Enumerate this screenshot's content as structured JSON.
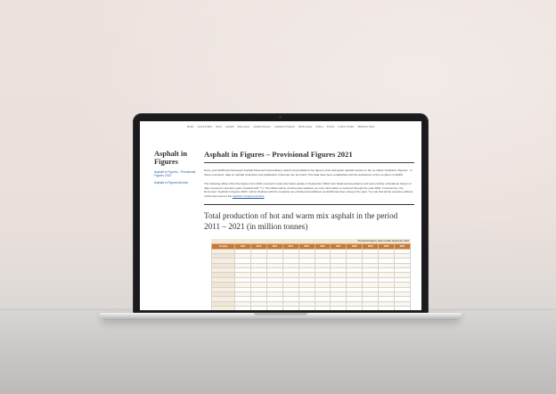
{
  "nav": {
    "items": [
      "Home",
      "About EAPA",
      "News",
      "Asphalt",
      "Innovation",
      "Asphalt Science",
      "Asphalt in Figures",
      "Publications",
      "Videos",
      "Events",
      "Contact EAPA",
      "Members Only"
    ]
  },
  "sidebar": {
    "title": "Asphalt in Figures",
    "links": [
      "Asphalt in Figures – Provisional Figures 2021",
      "Asphalt in Figures Archive"
    ]
  },
  "main": {
    "title": "Asphalt in Figures – Provisional Figures 2021",
    "intro": "Every year EAPA (the European Asphalt Pavement Association) collects and publishes key figures of the European asphalt industry in the so-called \"Asphalt in Figures\". In these overviews, data on asphalt production and application in Europe can be found. This data have been established with the assistance of the members of EAPA.",
    "body": "The following tables show the figures from 2021 received to date (the latest update is September 2022) from National Associations and some further estimations based on data received in previous years (marked with \"*\"). The tables will be continuously updated, as more information is received through the year 2022. In December, the Document \"Asphalt in Figures 2021\" will be finalised with the complete set of data and published, as EAPA has been doing in the past. You can find all the previous editions of this document in the",
    "archive_link": "Asphalt in Figures Archive",
    "section_title": "Total production of hot and warm mix asphalt in the period 2011 – 2021 (in million tonnes)",
    "table_caption": "Provisional figures, latest update September 2022",
    "columns": [
      "Country",
      "2011",
      "2012",
      "2013",
      "2014",
      "2015",
      "2016",
      "2017",
      "2018",
      "2019",
      "2020",
      "2021"
    ]
  }
}
